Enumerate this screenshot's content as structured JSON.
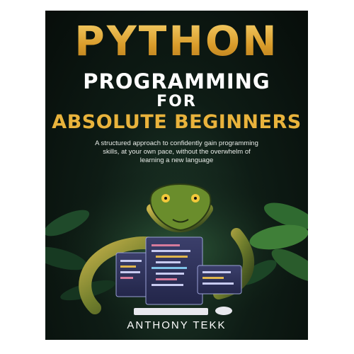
{
  "cover": {
    "title_line1": "PYTHON",
    "title_line2": "PROGRAMMING",
    "title_line3": "FOR",
    "title_line4": "ABSOLUTE BEGINNERS",
    "subtitle": "A structured approach to confidently gain programming skills, at your own pace, without the overwhelm of learning a new language",
    "author": "ANTHONY TEKK",
    "colors": {
      "gold": "#e9b33c",
      "background": "#0b1610",
      "text": "#ffffff"
    }
  }
}
